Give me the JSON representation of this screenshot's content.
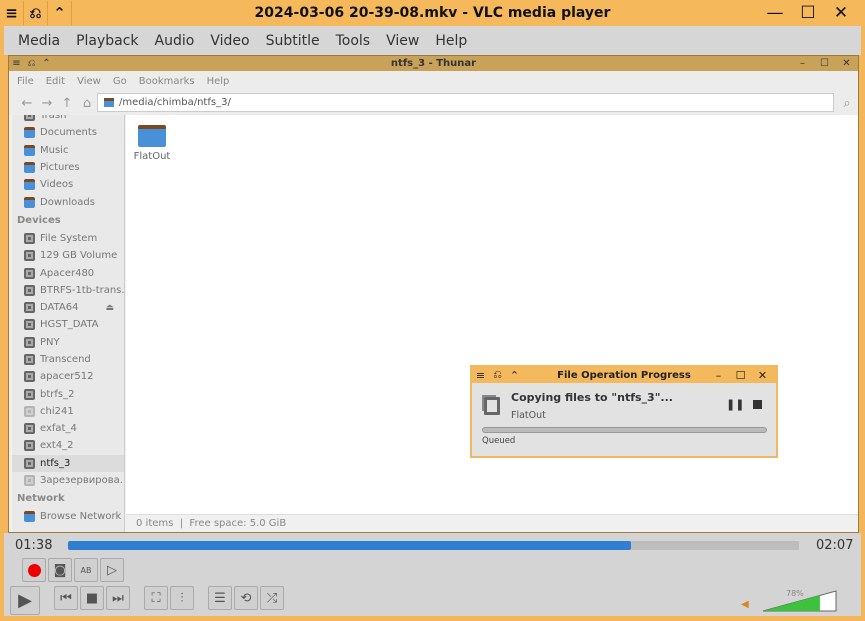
{
  "vlc": {
    "title": "2024-03-06 20-39-08.mkv - VLC media player",
    "menu": [
      "Media",
      "Playback",
      "Audio",
      "Video",
      "Subtitle",
      "Tools",
      "View",
      "Help"
    ],
    "time_elapsed": "01:38",
    "time_total": "02:07",
    "progress": 0.77,
    "volume_label": "78%",
    "volume": 0.78,
    "accent": "#2f7fd1"
  },
  "thunar": {
    "title": "ntfs_3 - Thunar",
    "menu": [
      "File",
      "Edit",
      "View",
      "Go",
      "Bookmarks",
      "Help"
    ],
    "location": "/media/chimba/ntfs_3/",
    "places": [
      "Trash",
      "Documents",
      "Music",
      "Pictures",
      "Videos",
      "Downloads"
    ],
    "devices_header": "Devices",
    "devices": [
      "File System",
      "129 GB Volume",
      "Apacer480",
      "BTRFS-1tb-trans...",
      "DATA64",
      "HGST_DATA",
      "PNY",
      "Transcend",
      "apacer512",
      "btrfs_2",
      "chi241",
      "exfat_4",
      "ext4_2",
      "ntfs_3",
      "Зарезервирова..."
    ],
    "selected_device": "ntfs_3",
    "network_header": "Network",
    "network": [
      "Browse Network"
    ],
    "files": [
      {
        "name": "FlatOut",
        "icon": "folder-icon"
      }
    ],
    "status": "0 items  |  Free space: 5.0 GiB"
  },
  "dialog": {
    "title": "File Operation Progress",
    "heading": "Copying files to \"ntfs_3\"...",
    "item": "FlatOut",
    "state": "Queued",
    "progress": 0
  }
}
